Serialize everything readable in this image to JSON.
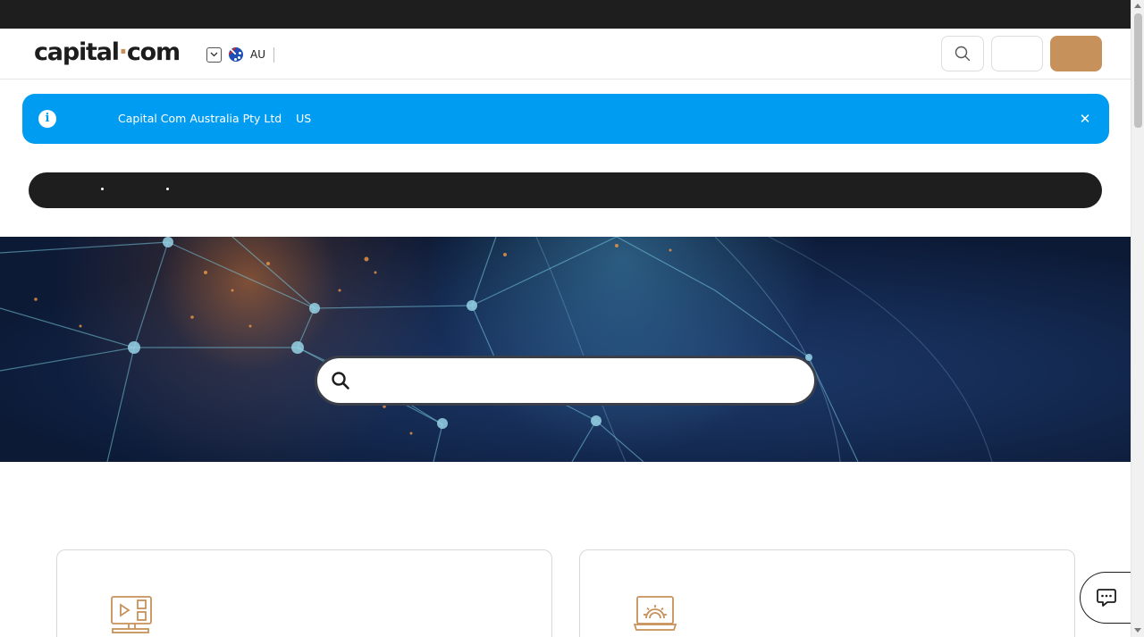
{
  "header": {
    "logo_main": "capital",
    "logo_dot": "·",
    "logo_end": "com",
    "region_code": "AU",
    "icons": {
      "region_toggle": "chevron-down-icon",
      "flag": "australia-flag-icon",
      "search": "search-icon"
    }
  },
  "notice": {
    "text": "Capital Com Australia Pty Ltd    US",
    "info_glyph": "i",
    "close_glyph": "✕",
    "background_color": "#009cf2"
  },
  "hero": {
    "search_icon": "search-icon"
  },
  "cards": [
    {
      "icon": "video-monitor-icon"
    },
    {
      "icon": "laptop-gear-icon"
    }
  ],
  "chat": {
    "icon": "chat-bubble-icon"
  },
  "colors": {
    "accent": "#c7915b",
    "topbar": "#1e1e1e",
    "notice": "#009cf2"
  }
}
